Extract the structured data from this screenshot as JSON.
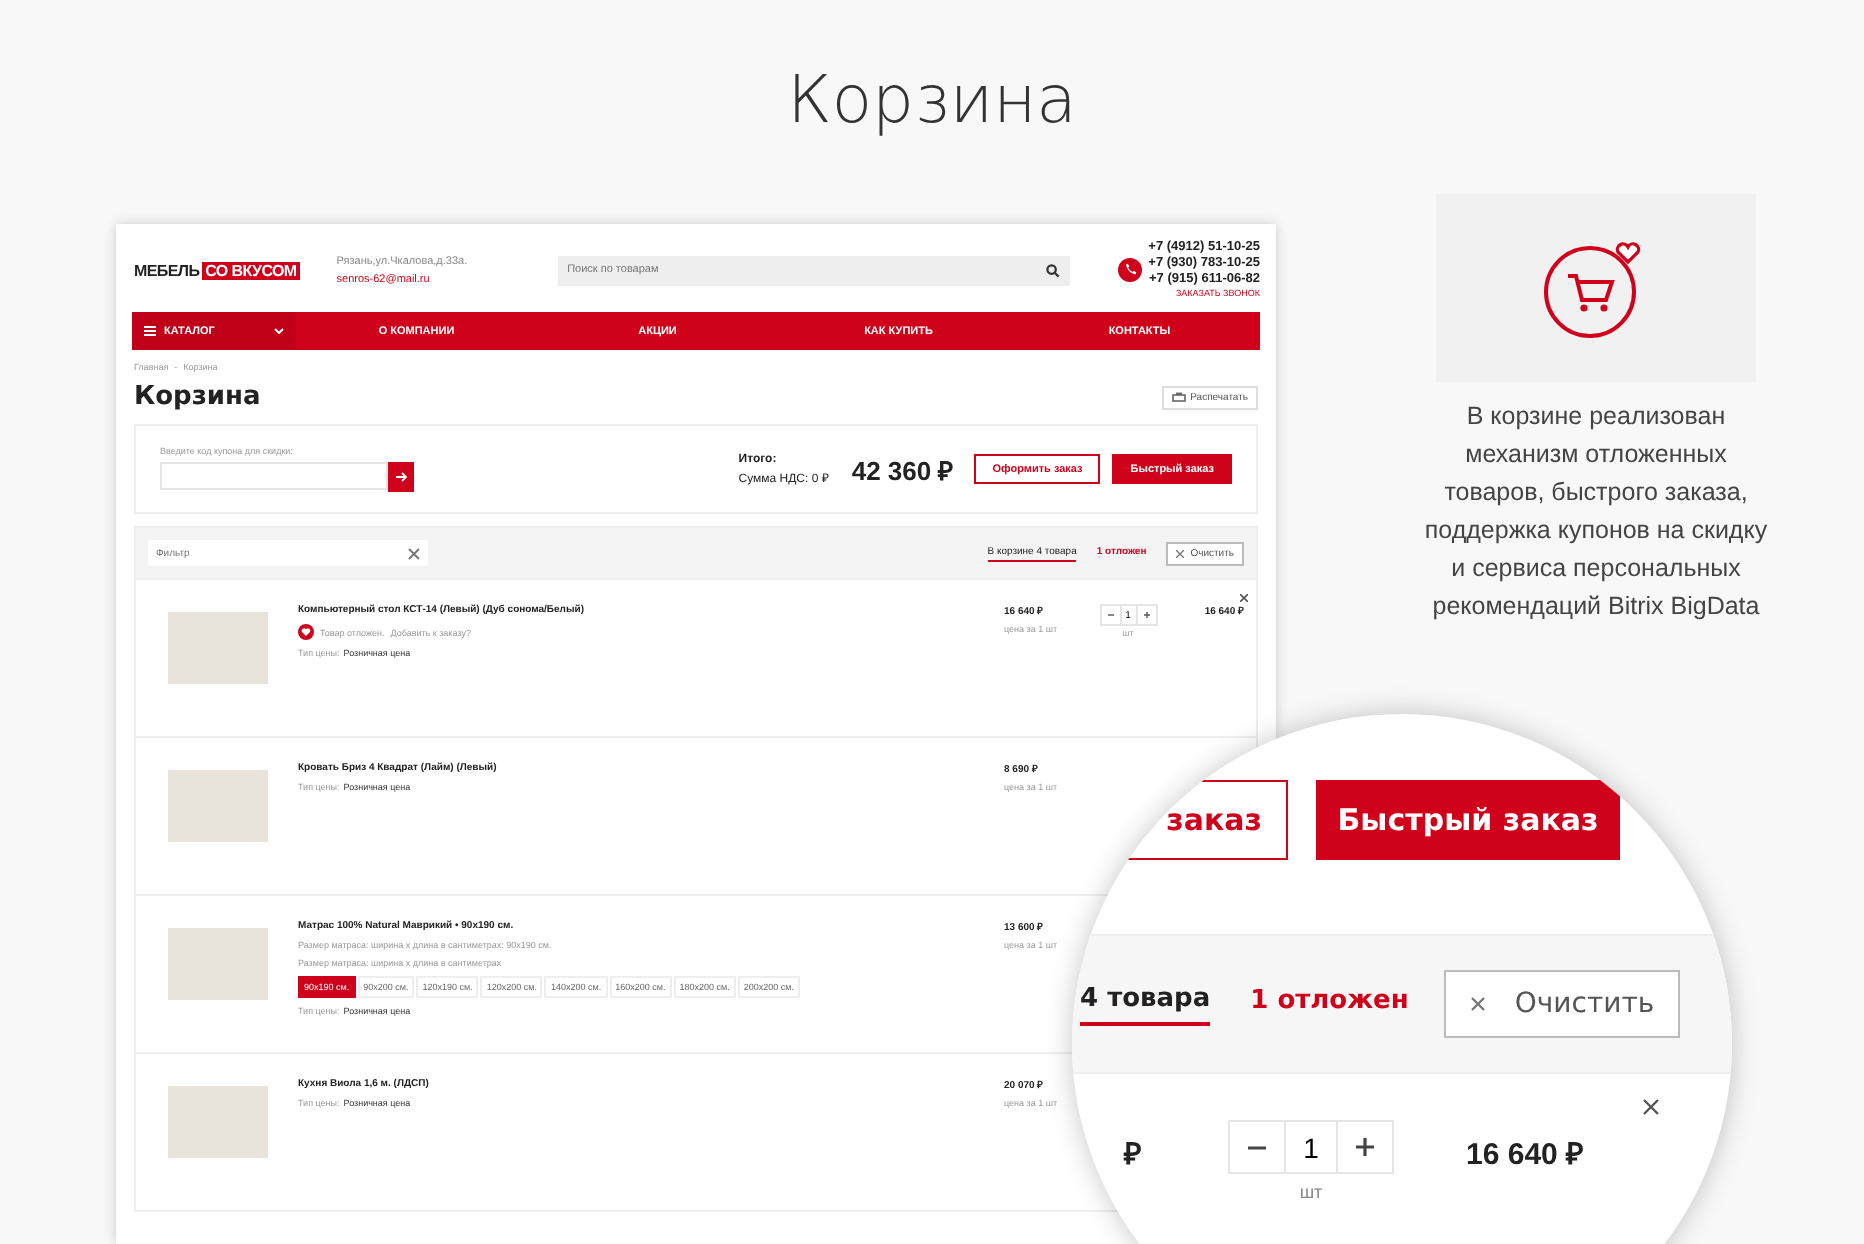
{
  "heading": "Корзина",
  "site": {
    "logo_left": "МЕБЕЛЬ",
    "logo_right": "СО ВКУСОМ",
    "address": "Рязань,ул.Чкалова,д.33а.",
    "email": "senros-62@mail.ru",
    "search": {
      "placeholder": "Поиск по товарам"
    },
    "phones": [
      "+7 (4912) 51-10-25",
      "+7 (930) 783-10-25",
      "+7 (915) 611-06-82"
    ],
    "callback": "ЗАКАЗАТЬ ЗВОНОК",
    "nav": [
      {
        "label": "КАТАЛОГ",
        "kind": "catalog"
      },
      {
        "label": "О КОМПАНИИ",
        "kind": "link"
      },
      {
        "label": "АКЦИИ",
        "kind": "link"
      },
      {
        "label": "КАК КУПИТЬ",
        "kind": "link"
      },
      {
        "label": "КОНТАКТЫ",
        "kind": "link"
      }
    ],
    "breadcrumbs": [
      "Главная",
      "Корзина"
    ],
    "breadcrumb_separator": "-",
    "page_title": "Корзина",
    "print_button": "Распечатать",
    "coupon": {
      "label": "Введите код купона для скидки:"
    },
    "total": {
      "label": "Итого:",
      "vat": "Сумма НДС: 0 ₽",
      "amount": "42 360 ₽"
    },
    "buttons": [
      {
        "label": "Оформить заказ",
        "kind": "outline"
      },
      {
        "label": "Быстрый заказ",
        "kind": "primary"
      }
    ],
    "filter": {
      "placeholder": "Фильтр"
    },
    "tabs": [
      {
        "label": "В корзине 4 товара",
        "selected": true
      },
      {
        "label": "1 отложен",
        "selected": false
      }
    ],
    "clear_button": "Очистить",
    "items": [
      {
        "name": "Компьютерный стол КСТ-14 (Левый) (Дуб сонома/Белый)",
        "deferred": true,
        "deferred_text": "Товар отложен.",
        "add_link": "Добавить к заказу?",
        "price_type_label": "Тип цены:",
        "price_type": "Розничная цена",
        "price": "16 640 ₽",
        "price_unit": "цена за 1 шт",
        "quantity": "1",
        "unit": "шт",
        "total": "16 640 ₽"
      },
      {
        "name": "Кровать Бриз 4 Квадрат (Лайм) (Левый)",
        "deferred": false,
        "price_type_label": "Тип цены:",
        "price_type": "Розничная цена",
        "price": "8 690 ₽",
        "price_unit": "цена за 1 шт"
      },
      {
        "name": "Матрас 100% Natural Маврикий • 90х190 см.",
        "deferred": false,
        "properties": [
          "Размер матраса: ширина х длина в сантиметрах: 90х190 см.",
          "Размер матраса: ширина х длина в сантиметрах"
        ],
        "options": [
          {
            "label": "90х190 см.",
            "selected": true
          },
          {
            "label": "90х200 см.",
            "selected": false
          },
          {
            "label": "120х190 см.",
            "selected": false
          },
          {
            "label": "120х200 см.",
            "selected": false
          },
          {
            "label": "140х200 см.",
            "selected": false
          },
          {
            "label": "160х200 см.",
            "selected": false
          },
          {
            "label": "180х200 см.",
            "selected": false
          },
          {
            "label": "200х200 см.",
            "selected": false
          }
        ],
        "price_type_label": "Тип цены:",
        "price_type": "Розничная цена",
        "price": "13 600 ₽",
        "price_unit": "цена за 1 шт"
      },
      {
        "name": "Кухня Виола 1,6 м. (ЛДСП)",
        "deferred": false,
        "price_type_label": "Тип цены:",
        "price_type": "Розничная цена",
        "price": "20 070 ₽",
        "price_unit": "цена за 1 шт"
      }
    ]
  },
  "feature": {
    "description": "В корзине реализован механизм отложенных товаров, быстрого заказа, поддержка купонов на скидку и сервиса персональных рекомендаций Bitrix BigData"
  },
  "magnifier": {
    "buttons": [
      {
        "label": "заказ",
        "kind": "outline"
      },
      {
        "label": "Быстрый заказ",
        "kind": "primary"
      }
    ],
    "tabs": [
      {
        "label": "4 товара",
        "selected": true
      },
      {
        "label": "1 отложен",
        "selected": false
      }
    ],
    "clear_button": "Очистить",
    "price_fragment": "₽",
    "quantity": "1",
    "unit": "шт",
    "total": "16 640 ₽"
  }
}
